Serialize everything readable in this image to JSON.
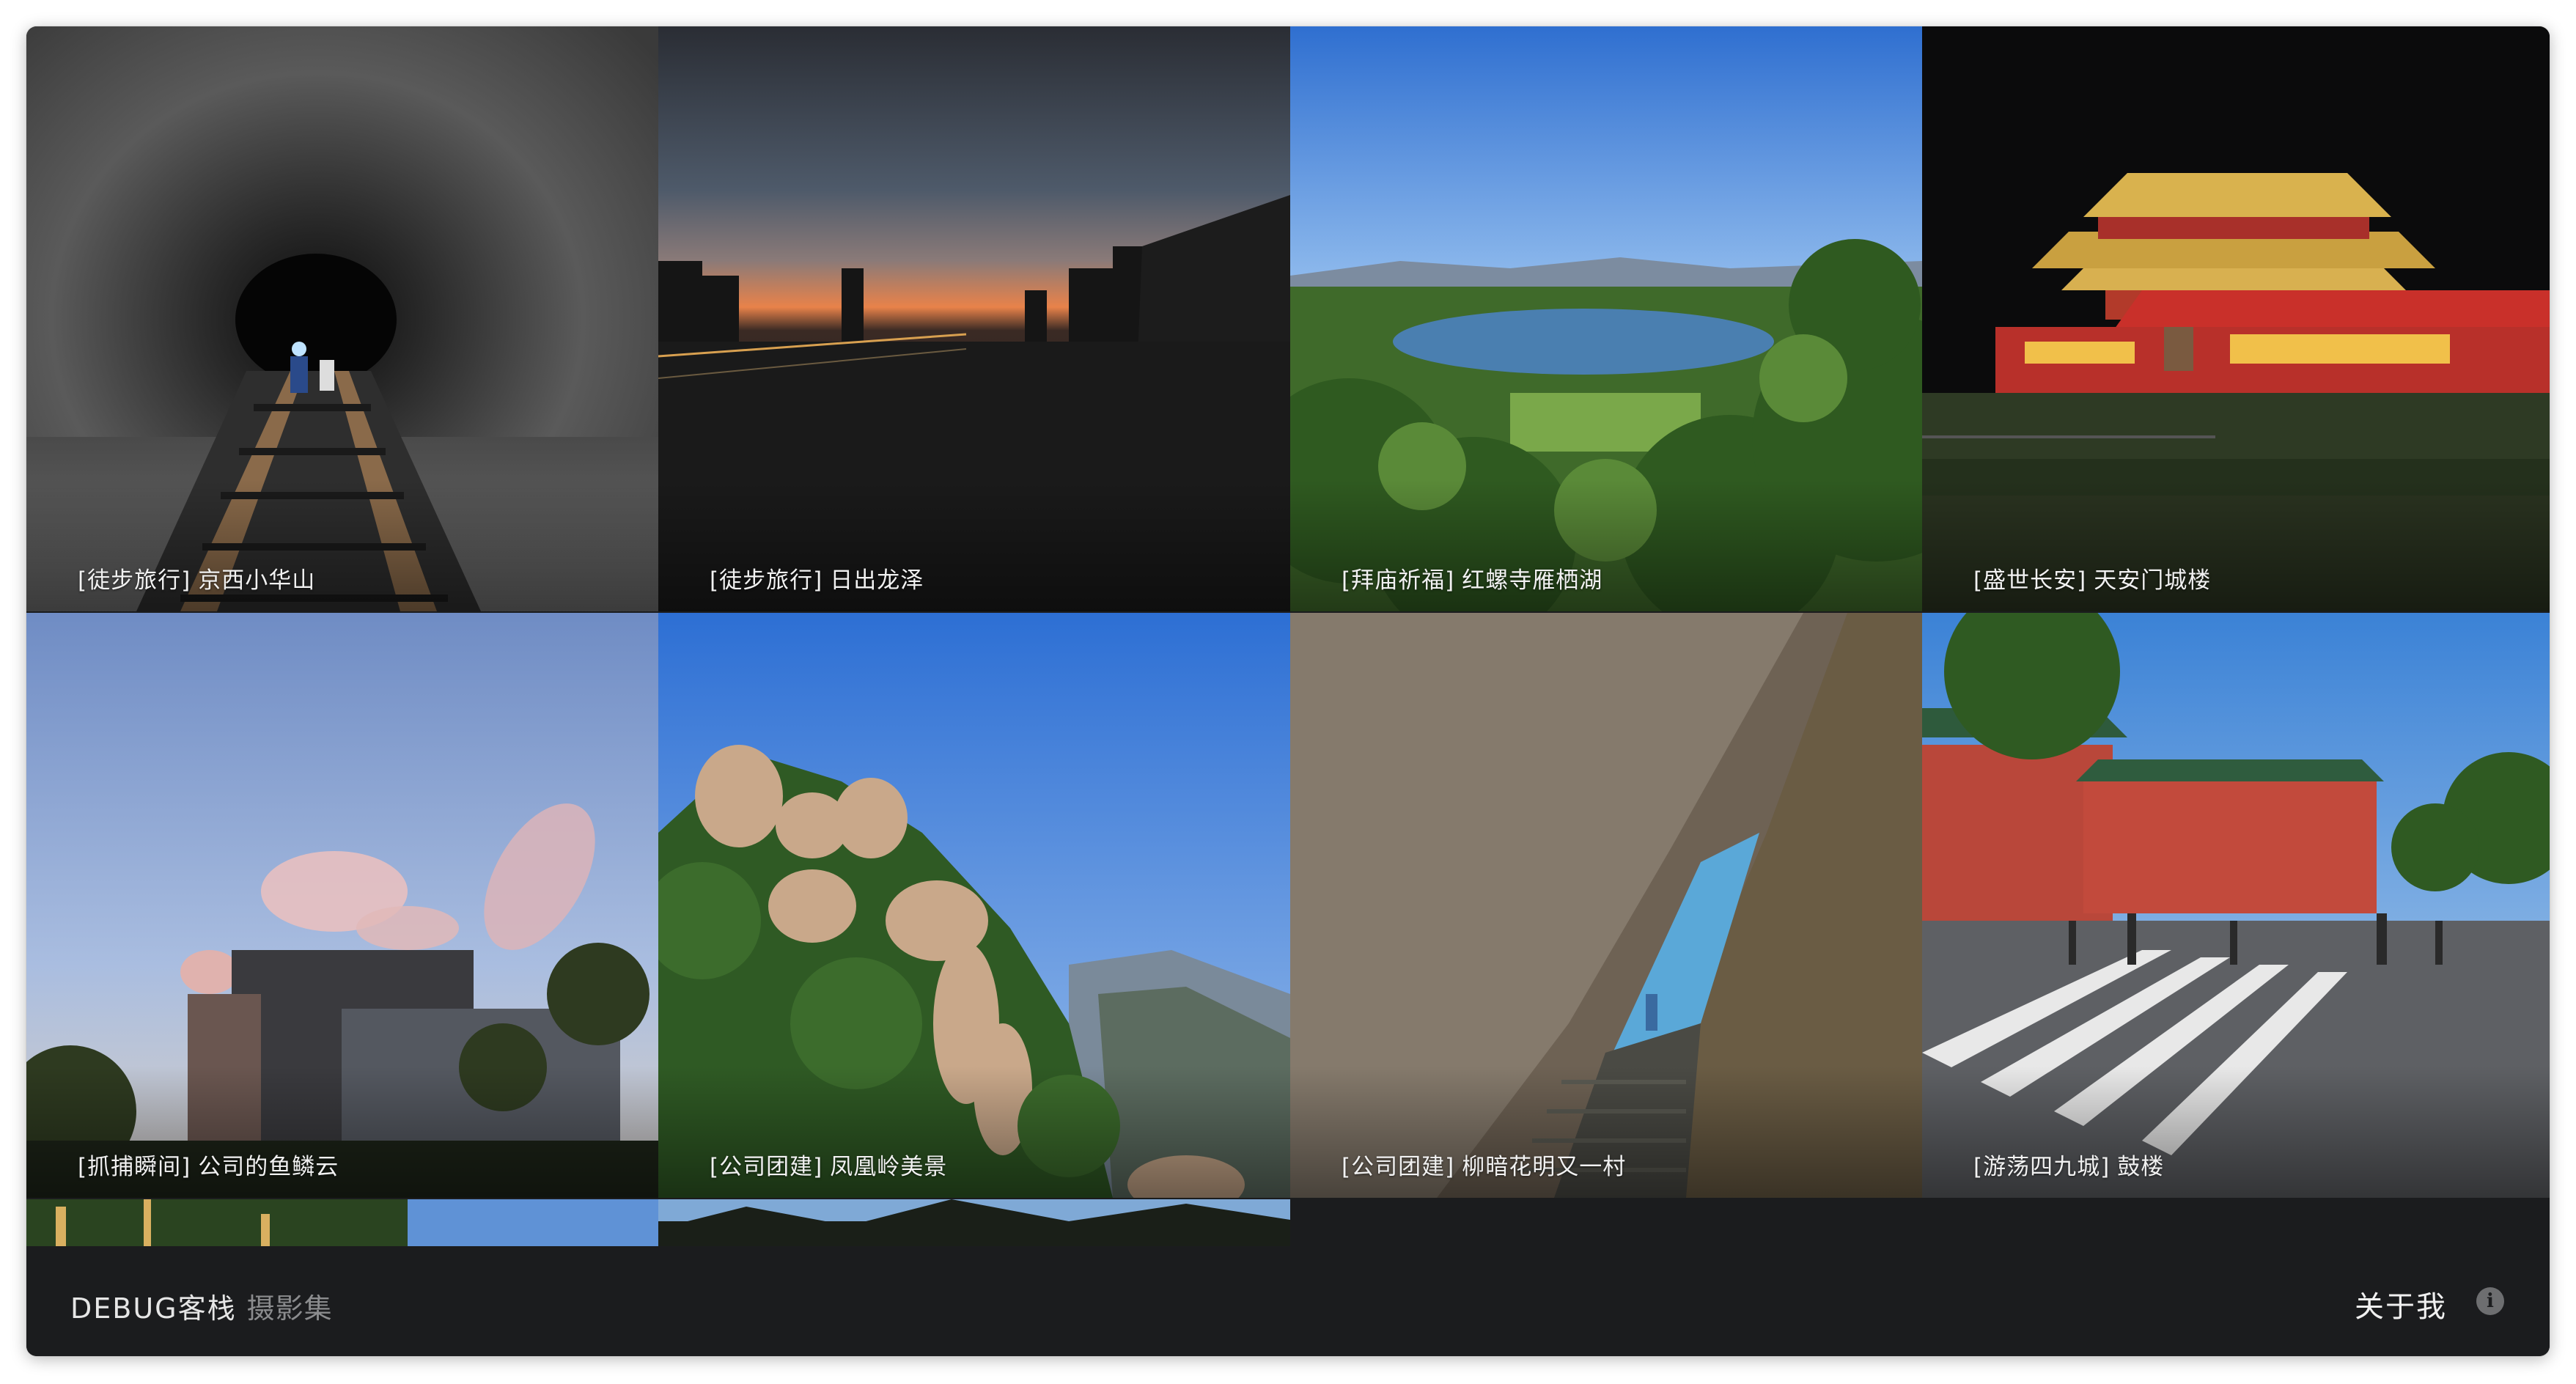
{
  "gallery": {
    "photos": [
      {
        "tag": "[徒步旅行]",
        "title": "京西小华山"
      },
      {
        "tag": "[徒步旅行]",
        "title": "日出龙泽"
      },
      {
        "tag": "[拜庙祈福]",
        "title": "红螺寺雁栖湖"
      },
      {
        "tag": "[盛世长安]",
        "title": "天安门城楼"
      },
      {
        "tag": "[抓捕瞬间]",
        "title": "公司的鱼鳞云"
      },
      {
        "tag": "[公司团建]",
        "title": "凤凰岭美景"
      },
      {
        "tag": "[公司团建]",
        "title": "柳暗花明又一村"
      },
      {
        "tag": "[游荡四九城]",
        "title": "鼓楼"
      }
    ],
    "partial_row_count": 2
  },
  "footer": {
    "brand": "DEBUG客栈",
    "subtitle": "摄影集",
    "about_label": "关于我",
    "info_icon": "info-icon"
  },
  "colors": {
    "footer_bg": "#1b1c1e",
    "brand_text": "#e6e6e6",
    "subtitle_text": "#8b8c8e"
  }
}
